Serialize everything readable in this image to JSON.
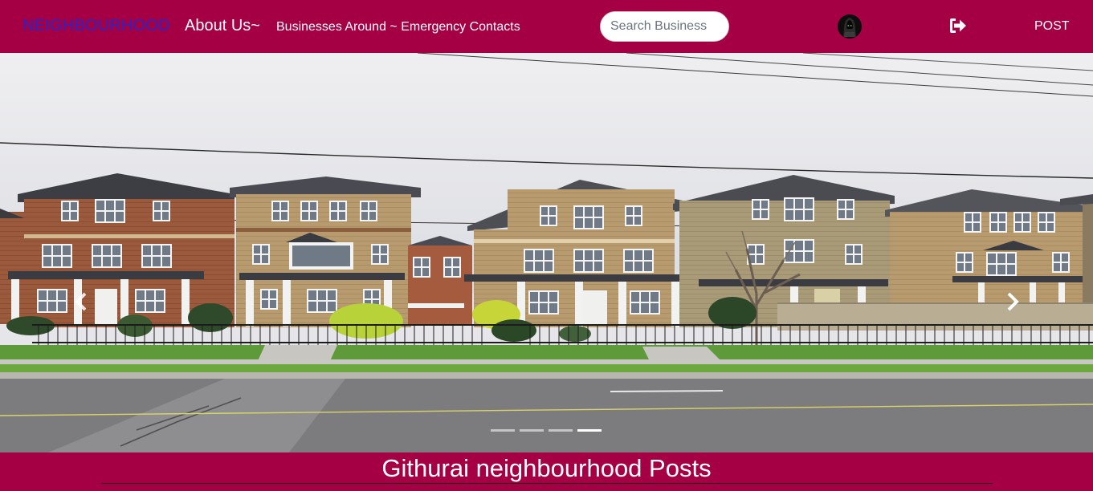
{
  "nav": {
    "brand": "NEIGHBOURHOOD",
    "about_label": "About Us~",
    "businesses_label": "Businesses Around ~ Emergency Contacts",
    "search_placeholder": "Search Business",
    "avatar_icon": "hooded-figure-avatar-icon",
    "logout_icon": "sign-out-icon",
    "post_label": "POST"
  },
  "carousel": {
    "prev_icon": "chevron-left-icon",
    "next_icon": "chevron-right-icon",
    "slide_count": 4,
    "active_index": 3
  },
  "posts": {
    "heading": "Githurai neighbourhood Posts"
  },
  "colors": {
    "brand_bg": "#a50044",
    "brand_link": "#2a24c8",
    "text": "#ffffff"
  }
}
